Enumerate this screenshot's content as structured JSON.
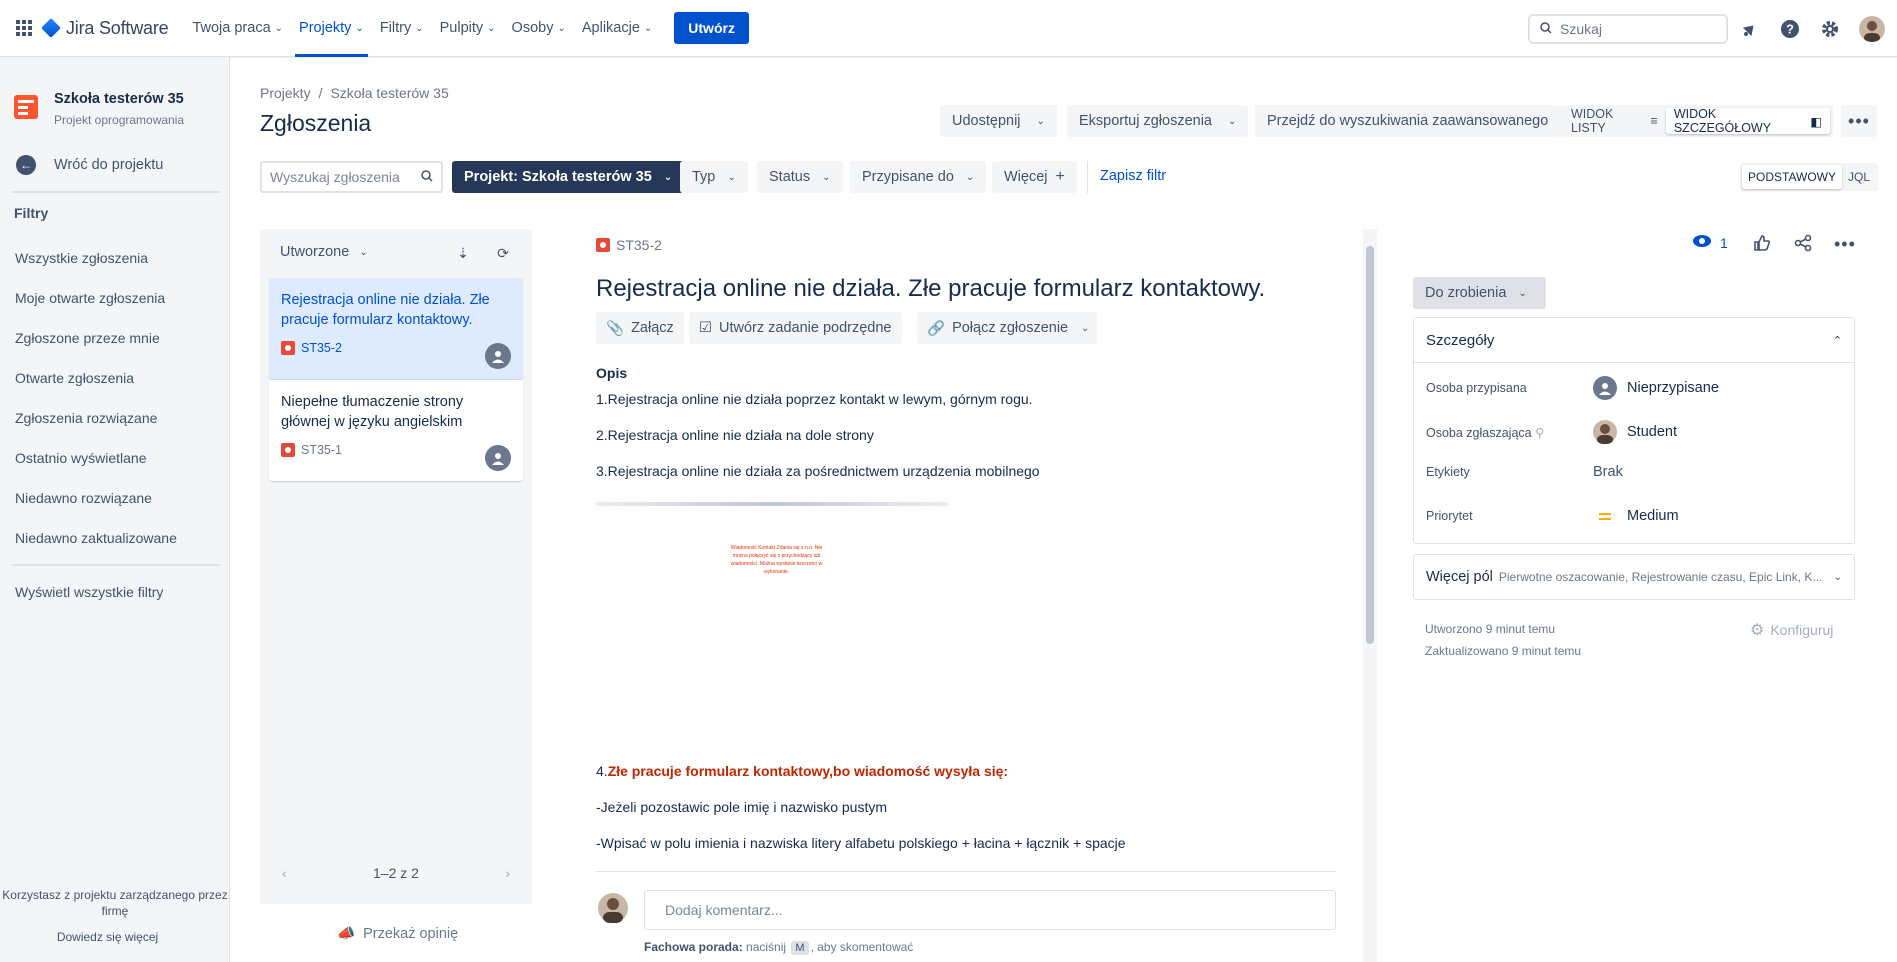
{
  "topnav": {
    "app_name": "Jira Software",
    "items": [
      {
        "label": "Twoja praca"
      },
      {
        "label": "Projekty"
      },
      {
        "label": "Filtry"
      },
      {
        "label": "Pulpity"
      },
      {
        "label": "Osoby"
      },
      {
        "label": "Aplikacje"
      }
    ],
    "active_index": 1,
    "create_label": "Utwórz",
    "search_placeholder": "Szukaj",
    "accent_color": "#0052CC"
  },
  "sidebar": {
    "project_name": "Szkoła testerów 35",
    "project_type": "Projekt oprogramowania",
    "back_label": "Wróć do projektu",
    "filters_heading": "Filtry",
    "filters": [
      {
        "label": "Wszystkie zgłoszenia"
      },
      {
        "label": "Moje otwarte zgłoszenia"
      },
      {
        "label": "Zgłoszone przeze mnie"
      },
      {
        "label": "Otwarte zgłoszenia"
      },
      {
        "label": "Zgłoszenia rozwiązane"
      },
      {
        "label": "Ostatnio wyświetlane"
      },
      {
        "label": "Niedawno rozwiązane"
      },
      {
        "label": "Niedawno zaktualizowane"
      }
    ],
    "all_filters_label": "Wyświetl wszystkie filtry",
    "footer_text": "Korzystasz z projektu zarządzanego przez firmę",
    "footer_link": "Dowiedz się więcej"
  },
  "header": {
    "breadcrumb": [
      "Projekty",
      "Szkoła testerów 35"
    ],
    "title": "Zgłoszenia",
    "share_label": "Udostępnij",
    "export_label": "Eksportuj zgłoszenia",
    "advanced_label": "Przejdź do wyszukiwania zaawansowanego",
    "list_view_label": "WIDOK LISTY",
    "detail_view_label": "WIDOK SZCZEGÓŁOWY"
  },
  "filterbar": {
    "search_placeholder": "Wyszukaj zgłoszenia",
    "project_filter": "Projekt: Szkoła testerów 35",
    "type_label": "Typ",
    "status_label": "Status",
    "assignee_label": "Przypisane do",
    "more_label": "Więcej",
    "save_label": "Zapisz filtr",
    "basic_label": "PODSTAWOWY",
    "jql_label": "JQL"
  },
  "issue_list": {
    "sort_label": "Utworzone",
    "issues": [
      {
        "title": "Rejestracja online nie działa. Złe pracuje formularz kontaktowy.",
        "key": "ST35-2"
      },
      {
        "title": "Niepełne tłumaczenie strony głównej w języku angielskim",
        "key": "ST35-1"
      }
    ],
    "pagination": "1–2 z 2",
    "feedback_label": "Przekaż opinię"
  },
  "detail": {
    "key": "ST35-2",
    "title": "Rejestracja online nie działa. Złe pracuje formularz kontaktowy.",
    "attach_label": "Załącz",
    "subtask_label": "Utwórz zadanie podrzędne",
    "link_label": "Połącz zgłoszenie",
    "description_heading": "Opis",
    "lines": [
      "1.Rejestracja online nie działa poprzez kontakt w lewym, górnym rogu.",
      "2.Rejestracja online nie działa na dole strony",
      "3.Rejestracja online nie działa za pośrednictwem urządzenia mobilnego"
    ],
    "attachment_text": "Wiadomość Kontakt Zdania się z n.n. Nie można połączyć się z przychodzący lub wiadomości. Można wysłanie tworzono w wykonanie.",
    "line4_prefix": "4.",
    "line4_red": "Złe pracuje formularz kontaktowy,bo wiadomość wysyła się:",
    "line5": "-Jeżeli pozostawic pole imię i nazwisko  pustym",
    "line6": "-Wpisać w polu imienia i nazwiska litery alfabetu polskiego + łacina + łącznik + spacje",
    "comment_placeholder": "Dodaj komentarz...",
    "tip_bold": "Fachowa porada:",
    "tip_pre": "naciśnij",
    "tip_key": "M",
    "tip_post": ", aby skomentować"
  },
  "right_panel": {
    "watch_count": "1",
    "status_label": "Do zrobienia",
    "details_heading": "Szczegóły",
    "fields": {
      "assignee_label": "Osoba przypisana",
      "assignee_value": "Nieprzypisane",
      "reporter_label": "Osoba zgłaszająca",
      "reporter_value": "Student",
      "labels_label": "Etykiety",
      "labels_value": "Brak",
      "priority_label": "Priorytet",
      "priority_value": "Medium"
    },
    "more_fields_label": "Więcej pól",
    "more_fields_sub": "Pierwotne oszacowanie, Rejestrowanie czasu, Epic Link, K...",
    "created": "Utworzono 9 minut temu",
    "updated": "Zaktualizowano 9 minut temu",
    "configure_label": "Konfiguruj"
  }
}
